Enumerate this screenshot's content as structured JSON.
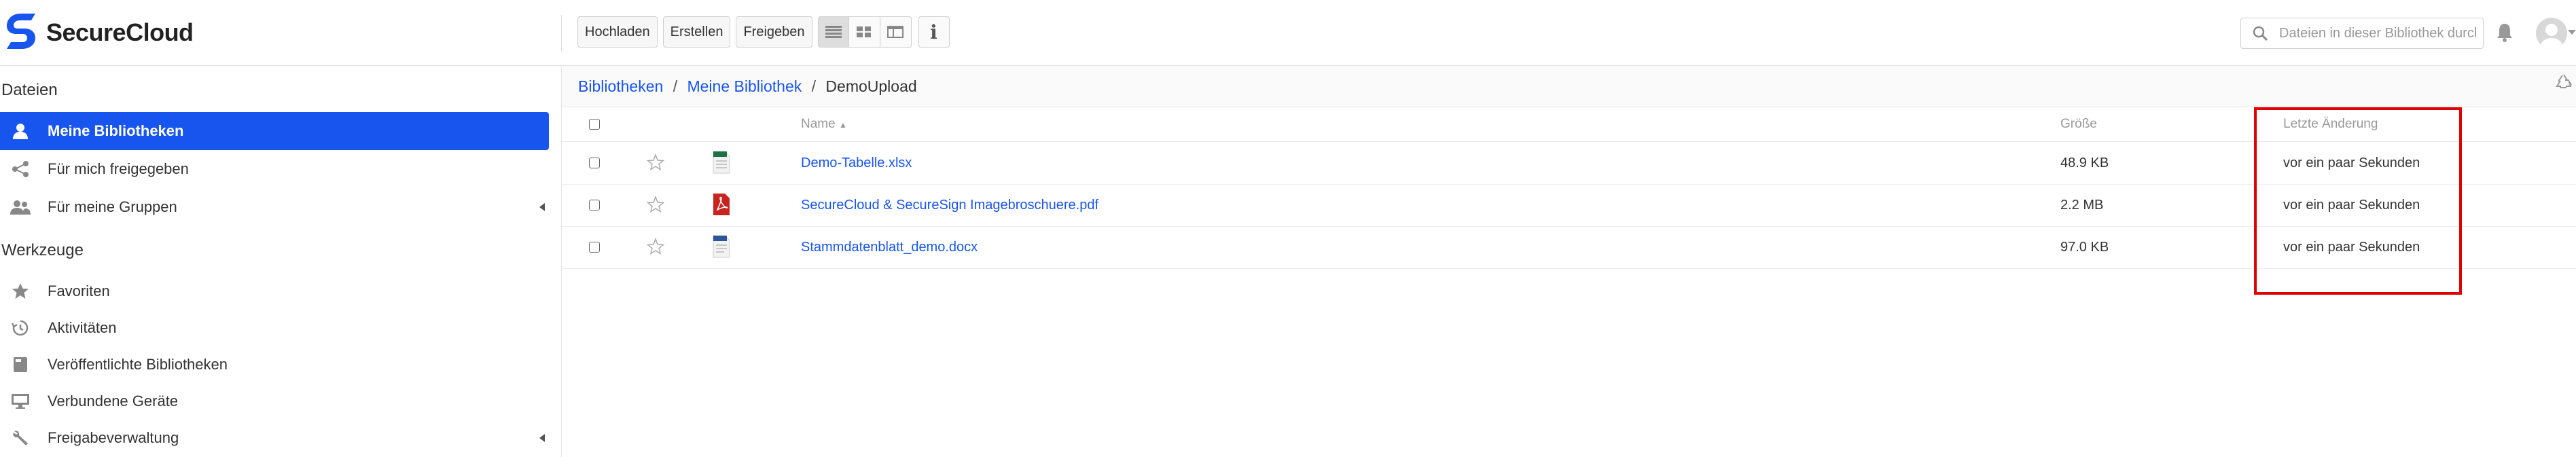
{
  "app": {
    "logo_text_bold": "Secure",
    "logo_text_rest": "Cloud",
    "brand_color": "#1854ee"
  },
  "toolbar": {
    "upload_label": "Hochladen",
    "create_label": "Erstellen",
    "share_label": "Freigeben",
    "info_label": "i",
    "view_modes": [
      "list-view-icon",
      "grid-view-icon",
      "column-view-icon"
    ],
    "active_view": "list-view-icon"
  },
  "search": {
    "placeholder": "Dateien in dieser Bibliothek durchsuchen"
  },
  "sidebar": {
    "files_title": "Dateien",
    "files_items": [
      {
        "label": "Meine Bibliotheken",
        "icon": "user-icon",
        "active": true
      },
      {
        "label": "Für mich freigegeben",
        "icon": "share-icon",
        "active": false
      },
      {
        "label": "Für meine Gruppen",
        "icon": "group-icon",
        "active": false,
        "has_arrow": true
      }
    ],
    "tools_title": "Werkzeuge",
    "tools_items": [
      {
        "label": "Favoriten",
        "icon": "star-icon"
      },
      {
        "label": "Aktivitäten",
        "icon": "history-icon"
      },
      {
        "label": "Veröffentlichte Bibliotheken",
        "icon": "published-library-icon"
      },
      {
        "label": "Verbundene Geräte",
        "icon": "monitor-icon"
      },
      {
        "label": "Freigabeverwaltung",
        "icon": "wrench-icon",
        "has_arrow": true
      }
    ]
  },
  "breadcrumb": {
    "items": [
      "Bibliotheken",
      "Meine Bibliothek"
    ],
    "separator": "/",
    "current": "DemoUpload"
  },
  "table": {
    "headers": {
      "name": "Name",
      "name_sort": "▲",
      "size": "Größe",
      "modified": "Letzte Änderung"
    },
    "rows": [
      {
        "name": "Demo-Tabelle.xlsx",
        "size": "48.9 KB",
        "modified": "vor ein paar Sekunden",
        "icon": "excel-file-icon"
      },
      {
        "name": "SecureCloud & SecureSign Imagebroschuere.pdf",
        "size": "2.2 MB",
        "modified": "vor ein paar Sekunden",
        "icon": "pdf-file-icon"
      },
      {
        "name": "Stammdatenblatt_demo.docx",
        "size": "97.0 KB",
        "modified": "vor ein paar Sekunden",
        "icon": "word-file-icon"
      }
    ]
  },
  "annotation": {
    "highlight_color": "#e00000",
    "highlighted_column": "Letzte Änderung"
  }
}
